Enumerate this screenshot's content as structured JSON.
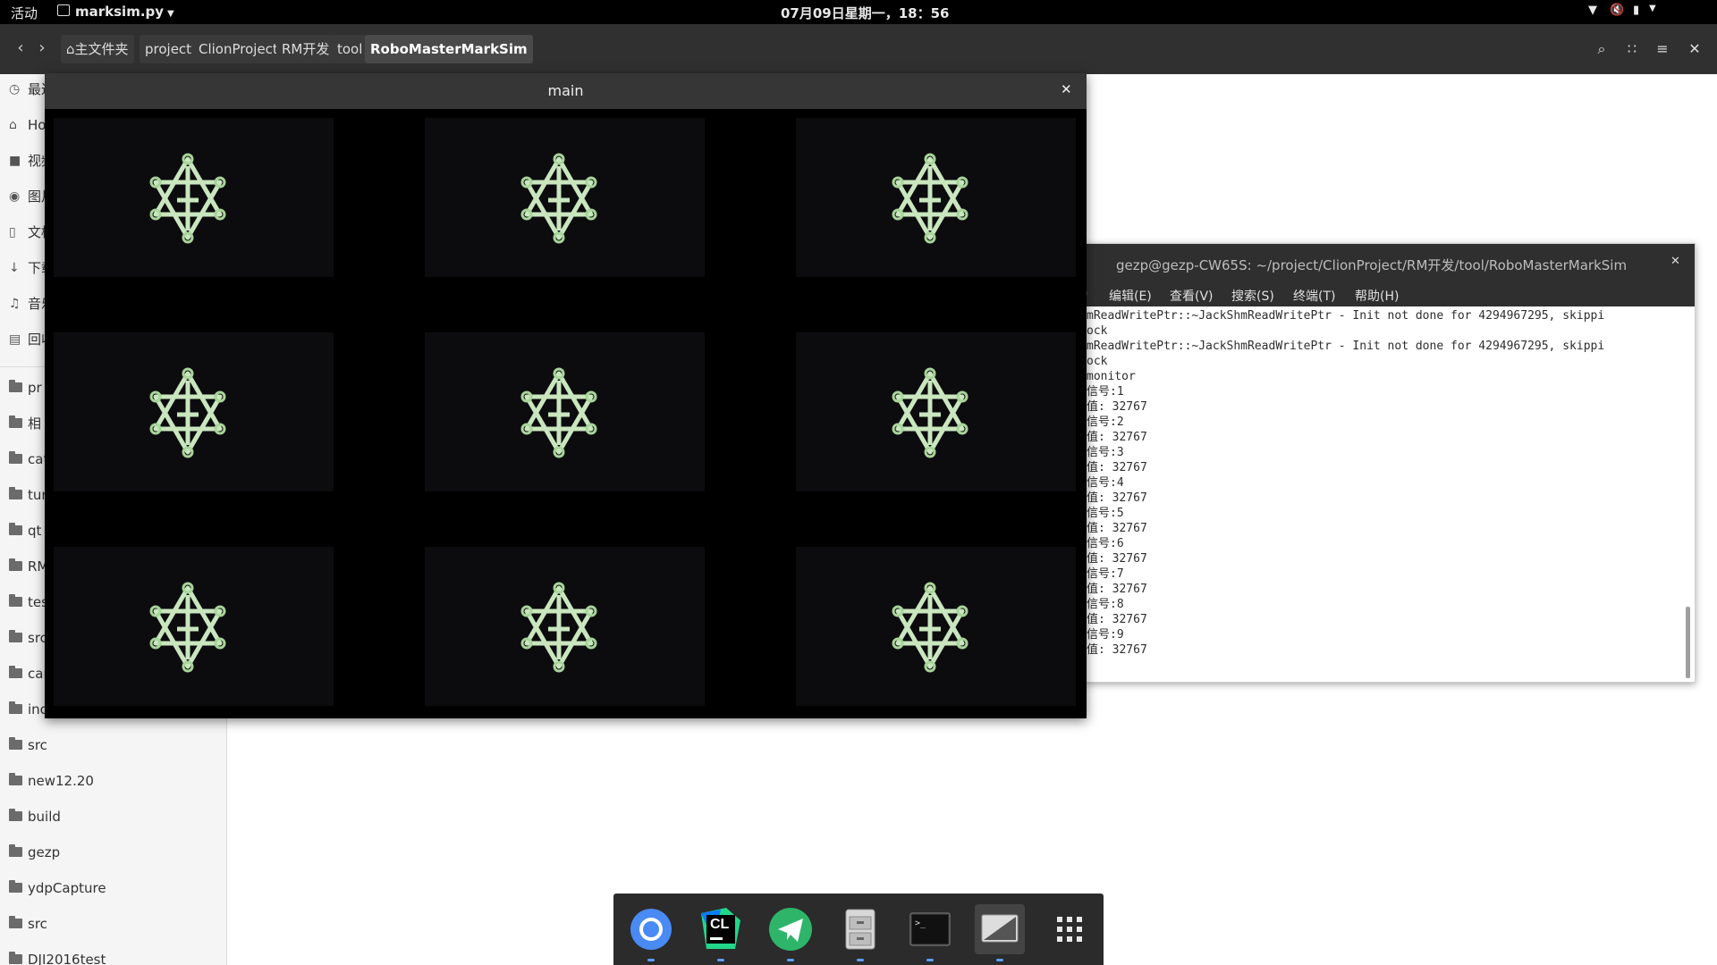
{
  "topbar": {
    "activities": "活动",
    "app_menu": "marksim.py",
    "clock": "07月09日星期一，18：56"
  },
  "filemanager": {
    "breadcrumbs": [
      "主文件夹",
      "project",
      "ClionProject",
      "RM开发",
      "tool",
      "RoboMasterMarkSim"
    ],
    "sidebar": {
      "places": [
        "最近",
        "Home",
        "视频",
        "图片",
        "文档",
        "下载",
        "音乐",
        "回收站"
      ],
      "bookmarks": [
        "pr",
        "相",
        "cat",
        "tur",
        "qt",
        "RM",
        "tes",
        "src",
        "cam",
        "inc",
        "src",
        "new12.20",
        "build",
        "gezp",
        "ydpCapture",
        "src",
        "DJI2016test"
      ]
    }
  },
  "terminal": {
    "title": "gezp@gezp-CW65S: ~/project/ClionProject/RM开发/tool/RoboMasterMarkSim",
    "menu": [
      ")",
      "编辑(E)",
      "查看(V)",
      "搜索(S)",
      "终端(T)",
      "帮助(H)"
    ],
    "lines": [
      "mReadWritePtr::~JackShmReadWritePtr - Init not done for 4294967295, skippi",
      "ock",
      "mReadWritePtr::~JackShmReadWritePtr - Init not done for 4294967295, skippi",
      "ock",
      "monitor",
      "信号:1",
      "值: 32767",
      "信号:2",
      "值: 32767",
      "信号:3",
      "值: 32767",
      "信号:4",
      "值: 32767",
      "信号:5",
      "值: 32767",
      "信号:6",
      "值: 32767",
      "信号:7",
      "值: 32767",
      "信号:8",
      "值: 32767",
      "信号:9",
      "值: 32767"
    ]
  },
  "mainwindow": {
    "title": "main",
    "tile_count": 9
  },
  "dock": {
    "apps": [
      "chrome-icon",
      "clion-icon",
      "telegram-icon",
      "files-icon",
      "terminal-icon",
      "image-viewer-icon",
      "app-grid-icon"
    ],
    "clion_text": "CL"
  }
}
